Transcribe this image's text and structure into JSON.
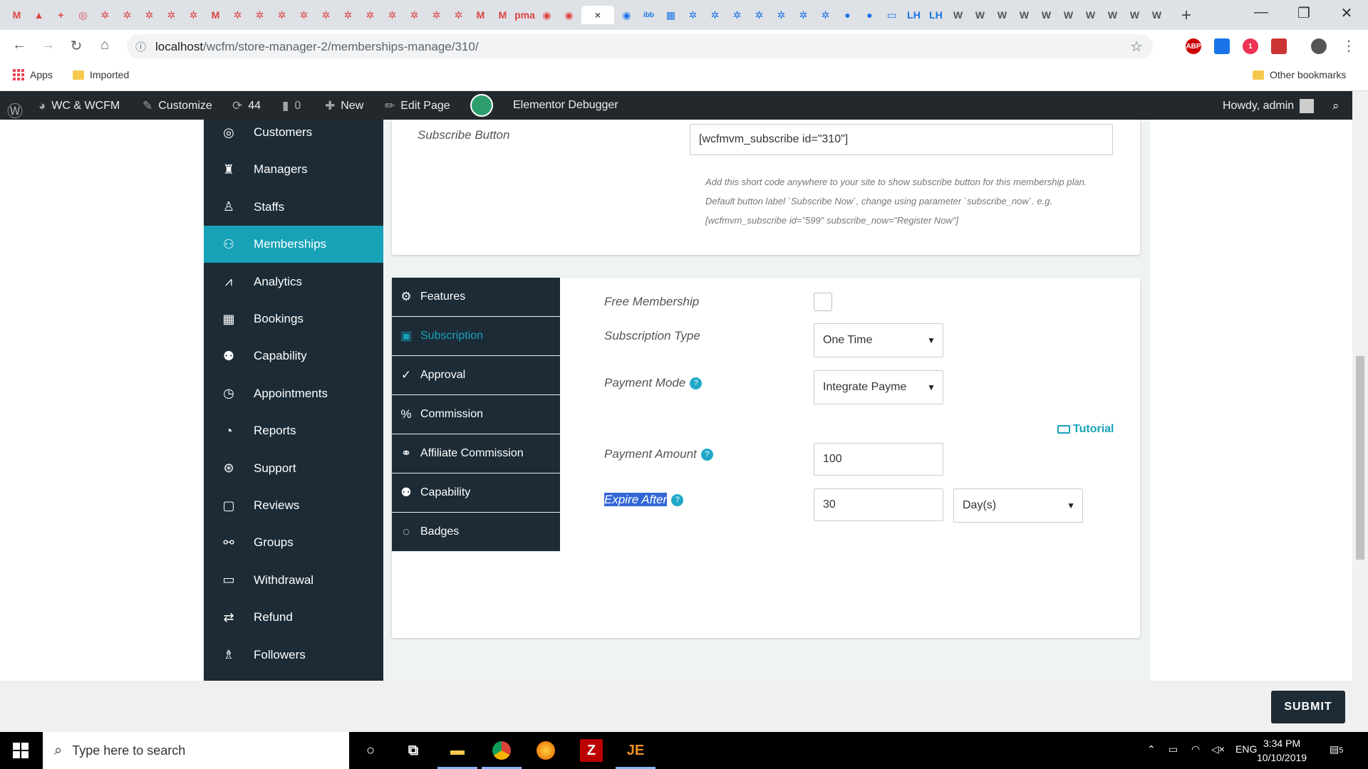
{
  "browser": {
    "tab_favicons": [
      "M",
      "▲",
      "+",
      "◎",
      "✲",
      "✲",
      "✲",
      "✲",
      "✲",
      "M",
      "✲",
      "✲",
      "✲",
      "✲",
      "✲",
      "✲",
      "✲",
      "✲",
      "✲",
      "✲",
      "✲",
      "M",
      "M",
      "pma",
      "◉",
      "◉"
    ],
    "active_tab_close": "×",
    "after_tab_favicons": [
      "◉",
      "ibb",
      "▦",
      "✲",
      "✲",
      "✲",
      "✲",
      "✲",
      "✲",
      "✲",
      "●",
      "●",
      "▭",
      "LH",
      "LH",
      "W",
      "W",
      "W",
      "W",
      "W",
      "W",
      "W",
      "W",
      "W",
      "W"
    ],
    "new_tab": "+",
    "url_host": "localhost",
    "url_path": "/wcfm/store-manager-2/memberships-manage/310/",
    "extensions": [
      "ABP",
      "",
      "1",
      ""
    ],
    "bookmarks": {
      "apps": "Apps",
      "imported": "Imported",
      "other": "Other bookmarks"
    }
  },
  "adminbar": {
    "site": "WC & WCFM",
    "customize": "Customize",
    "updates": "44",
    "comments": "0",
    "new": "New",
    "edit_page": "Edit Page",
    "debugger": "Elementor Debugger",
    "howdy": "Howdy, admin"
  },
  "sidebar": {
    "items": [
      {
        "label": "Customers",
        "icon": "user-circle-icon"
      },
      {
        "label": "Managers",
        "icon": "user-tie-icon"
      },
      {
        "label": "Staffs",
        "icon": "user-icon"
      },
      {
        "label": "Memberships",
        "icon": "user-plus-icon",
        "active": true
      },
      {
        "label": "Analytics",
        "icon": "chart-line-icon"
      },
      {
        "label": "Bookings",
        "icon": "calendar-icon"
      },
      {
        "label": "Capability",
        "icon": "user-times-icon"
      },
      {
        "label": "Appointments",
        "icon": "clock-icon"
      },
      {
        "label": "Reports",
        "icon": "pie-chart-icon"
      },
      {
        "label": "Support",
        "icon": "life-ring-icon"
      },
      {
        "label": "Reviews",
        "icon": "comment-icon"
      },
      {
        "label": "Groups",
        "icon": "users-icon"
      },
      {
        "label": "Withdrawal",
        "icon": "credit-card-icon"
      },
      {
        "label": "Refund",
        "icon": "retweet-icon"
      },
      {
        "label": "Followers",
        "icon": "child-icon"
      }
    ]
  },
  "subscribe_card": {
    "label": "Subscribe Button",
    "value": "[wcfmvm_subscribe id=\"310\"]",
    "help1": "Add this short code anywhere to your site to show subscribe button for this membership plan.",
    "help2": "Default button label `Subscribe Now`, change using parameter `subscribe_now`. e.g.",
    "help3": "[wcfmvm_subscribe id=\"599\" subscribe_now=\"Register Now\"]"
  },
  "tabs": [
    {
      "label": "Features",
      "icon": "gear-icon"
    },
    {
      "label": "Subscription",
      "icon": "money-icon",
      "active": true
    },
    {
      "label": "Approval",
      "icon": "check-circle-icon"
    },
    {
      "label": "Commission",
      "icon": "percent-icon"
    },
    {
      "label": "Affiliate Commission",
      "icon": "user-friends-icon"
    },
    {
      "label": "Capability",
      "icon": "user-times-icon"
    },
    {
      "label": "Badges",
      "icon": "circle-notch-icon"
    }
  ],
  "form": {
    "free_membership": "Free Membership",
    "subscription_type": "Subscription Type",
    "subscription_type_value": "One Time",
    "payment_mode": "Payment Mode",
    "payment_mode_value": "Integrate Payme",
    "tutorial": "Tutorial",
    "payment_amount": "Payment Amount",
    "payment_amount_value": "100",
    "expire_after": "Expire After",
    "expire_after_value": "30",
    "expire_unit": "Day(s)",
    "help_mark": "?",
    "select_arrow": "▼"
  },
  "submit": "SUBMIT",
  "taskbar": {
    "search": "Type here to search",
    "lang": "ENG",
    "time": "3:34 PM",
    "date": "10/10/2019",
    "notif": "5"
  },
  "colors": {
    "accent": "#17a2b8",
    "sidebar": "#1c2b36",
    "adminbar": "#23282d"
  }
}
